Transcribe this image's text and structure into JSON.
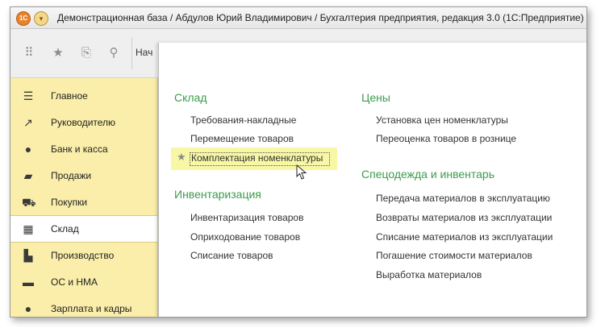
{
  "window": {
    "logo_text": "1С",
    "title": "Демонстрационная база / Абдулов Юрий Владимирович / Бухгалтерия предприятия, редакция 3.0  (1С:Предприятие)"
  },
  "toolbar": {
    "icons": [
      "apps-grid-icon",
      "star-icon",
      "history-icon",
      "search-icon"
    ],
    "tab_label": "Нач"
  },
  "sidebar": {
    "items": [
      {
        "label": "Главное",
        "icon": "menu-lines-icon",
        "active": false
      },
      {
        "label": "Руководителю",
        "icon": "trend-chart-icon",
        "active": false
      },
      {
        "label": "Банк и касса",
        "icon": "ruble-coin-icon",
        "active": false
      },
      {
        "label": "Продажи",
        "icon": "shopping-bag-icon",
        "active": false
      },
      {
        "label": "Покупки",
        "icon": "shopping-cart-icon",
        "active": false
      },
      {
        "label": "Склад",
        "icon": "warehouse-grid-icon",
        "active": true
      },
      {
        "label": "Производство",
        "icon": "factory-icon",
        "active": false
      },
      {
        "label": "ОС и НМА",
        "icon": "truck-icon",
        "active": false
      },
      {
        "label": "Зарплата и кадры",
        "icon": "person-icon",
        "active": false
      }
    ]
  },
  "panel": {
    "sections": [
      {
        "title": "Склад",
        "links": [
          "Требования-накладные",
          "Перемещение товаров",
          "Комплектация номенклатуры"
        ]
      },
      {
        "title": "Инвентаризация",
        "links": [
          "Инвентаризация товаров",
          "Оприходование товаров",
          "Списание товаров"
        ]
      },
      {
        "title": "Цены",
        "links": [
          "Установка цен номенклатуры",
          "Переоценка товаров в рознице"
        ]
      },
      {
        "title": "Спецодежда и инвентарь",
        "links": [
          "Передача материалов в эксплуатацию",
          "Возвраты материалов из эксплуатации",
          "Списание материалов из эксплуатации",
          "Погашение стоимости материалов",
          "Выработка материалов"
        ]
      }
    ],
    "highlighted_link": "Комплектация номенклатуры",
    "colors": {
      "section_heading": "#3c9c4c",
      "highlight": "#f7f7a5",
      "sidebar": "#faeeaa"
    }
  }
}
